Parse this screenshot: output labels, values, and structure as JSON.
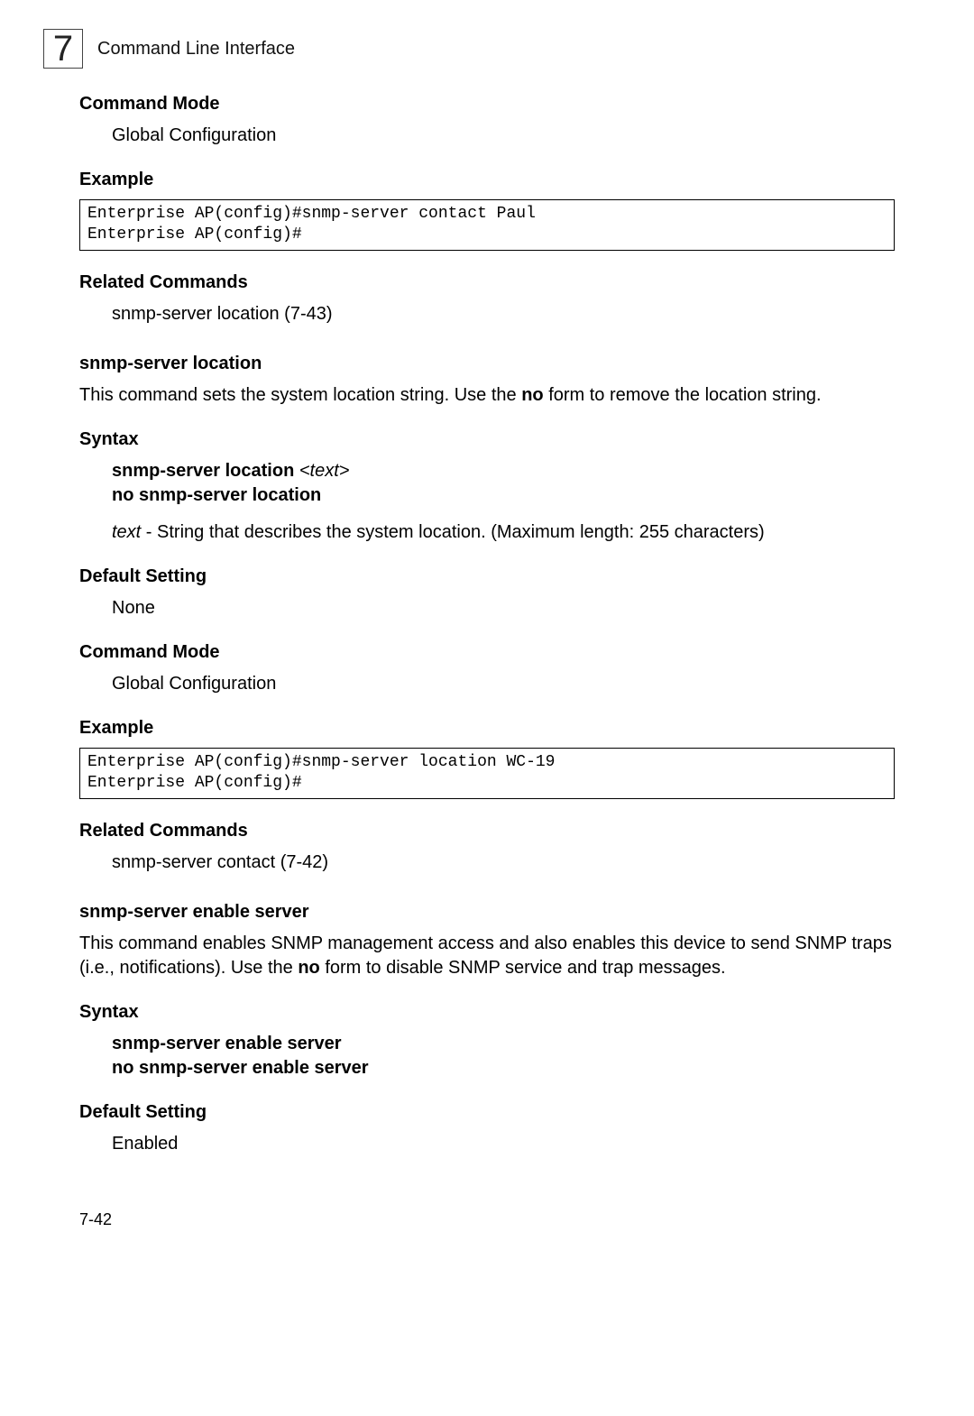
{
  "header": {
    "chapterNumber": "7",
    "title": "Command Line Interface"
  },
  "s1": {
    "cmdModeHead": "Command Mode",
    "cmdModeBody": "Global Configuration",
    "exampleHead": "Example",
    "exampleCode": "Enterprise AP(config)#snmp-server contact Paul\nEnterprise AP(config)#",
    "relatedHead": "Related Commands",
    "relatedBody": "snmp-server location (7-43)"
  },
  "s2": {
    "title": "snmp-server location",
    "descPre": "This command sets the system location string. Use the ",
    "descBold": "no",
    "descPost": " form to remove the location string.",
    "syntaxHead": "Syntax",
    "syntaxLine1a": "snmp-server location ",
    "syntaxLine1b": "<text>",
    "syntaxLine2": "no snmp-server location",
    "paramLabel": "text",
    "paramDesc": " - String that describes the system location. (Maximum length: 255 characters)",
    "defaultHead": "Default Setting",
    "defaultBody": "None",
    "cmdModeHead": "Command Mode",
    "cmdModeBody": "Global Configuration",
    "exampleHead": "Example",
    "exampleCode": "Enterprise AP(config)#snmp-server location WC-19\nEnterprise AP(config)#",
    "relatedHead": "Related Commands",
    "relatedBody": "snmp-server contact (7-42)"
  },
  "s3": {
    "title": "snmp-server enable server",
    "descPre": "This command enables SNMP management access and also enables this device to send SNMP traps (i.e., notifications). Use the ",
    "descBold": "no",
    "descPost": " form to disable SNMP service and trap messages.",
    "syntaxHead": "Syntax",
    "syntaxLine1": "snmp-server enable server",
    "syntaxLine2": "no snmp-server enable server",
    "defaultHead": "Default Setting",
    "defaultBody": "Enabled"
  },
  "pageNumber": "7-42"
}
